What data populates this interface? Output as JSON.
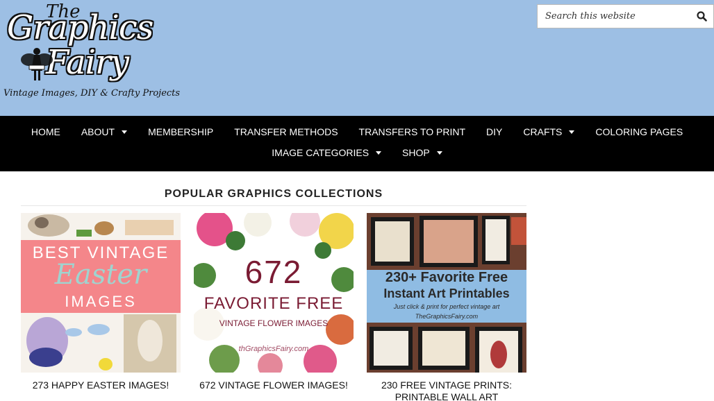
{
  "header": {
    "logo": {
      "line1": "The",
      "line2": "Graphics",
      "line3": "Fairy",
      "tagline": "Vintage Images, DIY & Crafty Projects"
    },
    "search": {
      "placeholder": "Search this website",
      "icon": "search-icon"
    },
    "background_color": "#9dbfe4"
  },
  "nav": {
    "items": [
      {
        "label": "HOME",
        "has_dropdown": false
      },
      {
        "label": "ABOUT",
        "has_dropdown": true
      },
      {
        "label": "MEMBERSHIP",
        "has_dropdown": false
      },
      {
        "label": "TRANSFER METHODS",
        "has_dropdown": false
      },
      {
        "label": "TRANSFERS TO PRINT",
        "has_dropdown": false
      },
      {
        "label": "DIY",
        "has_dropdown": false
      },
      {
        "label": "CRAFTS",
        "has_dropdown": true
      },
      {
        "label": "COLORING PAGES",
        "has_dropdown": false
      },
      {
        "label": "IMAGE CATEGORIES",
        "has_dropdown": true
      },
      {
        "label": "SHOP",
        "has_dropdown": true
      }
    ]
  },
  "main": {
    "section_title": "POPULAR GRAPHICS COLLECTIONS",
    "cards": [
      {
        "caption": "273 HAPPY EASTER IMAGES!",
        "thumb": {
          "line1": "BEST VINTAGE",
          "line2": "Easter",
          "line3": "IMAGES"
        }
      },
      {
        "caption": "672 VINTAGE FLOWER IMAGES!",
        "thumb": {
          "line1": "672",
          "line2": "FAVORITE FREE",
          "line3": "VINTAGE FLOWER IMAGES",
          "watermark": "thGraphicsFairy.com"
        }
      },
      {
        "caption": "230 FREE VINTAGE PRINTS: PRINTABLE WALL ART",
        "thumb": {
          "line1": "230+ Favorite Free",
          "line2": "Instant Art Printables",
          "line3": "Just click & print for perfect vintage art",
          "line4": "TheGraphicsFairy.com"
        }
      }
    ]
  }
}
